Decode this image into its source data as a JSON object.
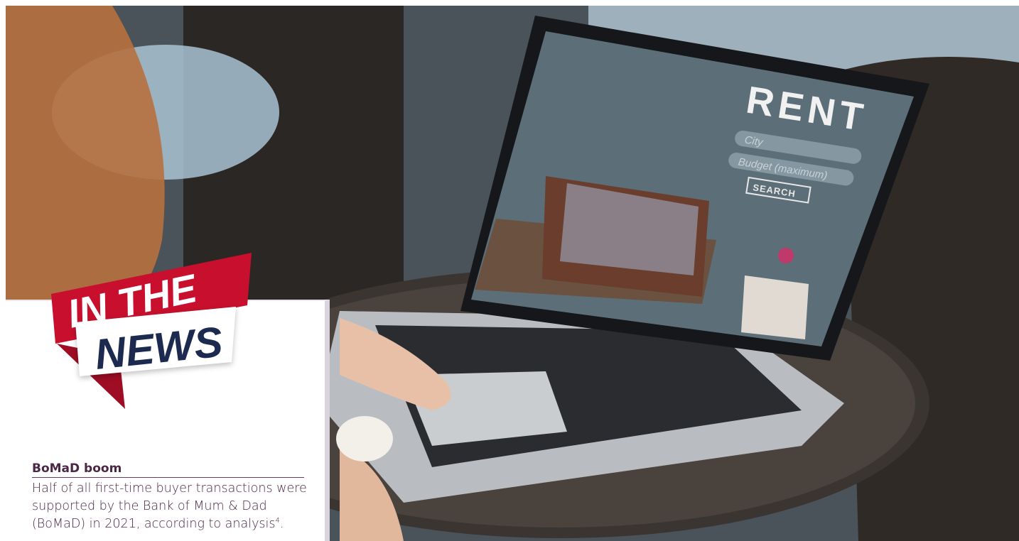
{
  "photo": {
    "screen_heading": "RENT",
    "field_city": "City",
    "field_budget": "Budget (maximum)",
    "search_button": "SEARCH",
    "colors": {
      "screen_wall": "#5c6f79",
      "sofa": "#6a3d2c",
      "laptop_body": "#b9bdc1"
    }
  },
  "banner": {
    "line1": "IN THE",
    "line2": "NEWS",
    "colors": {
      "red": "#c8102e",
      "navy": "#1b2a4e"
    }
  },
  "story": {
    "title": "BoMaD boom",
    "body": "Half of all first-time buyer transactions were supported by the Bank of Mum & Dad (BoMaD) in 2021, according to analysis",
    "footnote": "4",
    "tail": "."
  }
}
